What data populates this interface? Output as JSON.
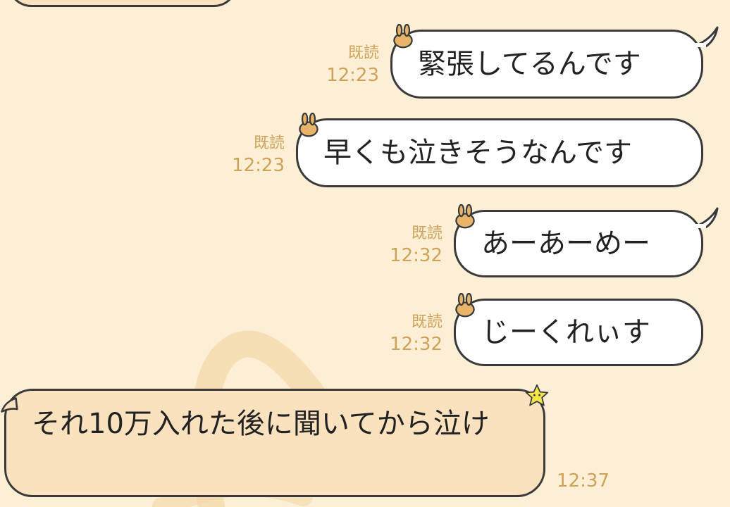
{
  "messages": [
    {
      "type": "sent",
      "read": "既読",
      "time": "12:23",
      "text": "緊張してるんです"
    },
    {
      "type": "sent",
      "read": "既読",
      "time": "12:23",
      "text": "早くも泣きそうなんです"
    },
    {
      "type": "sent",
      "read": "既読",
      "time": "12:32",
      "text": "あーあーめー"
    },
    {
      "type": "sent",
      "read": "既読",
      "time": "12:32",
      "text": "じーくれぃす"
    },
    {
      "type": "received",
      "time": "12:37",
      "text": "それ10万入れた後に聞いてから泣け"
    }
  ],
  "theme": {
    "background": "#FCEFD5",
    "sent_bubble": "#FFFFFF",
    "received_bubble": "#FBE2BE",
    "meta_text": "#CFA25A",
    "outline": "#3A3A3A"
  },
  "icons": [
    "bunny-ears-icon",
    "star-sticker-icon"
  ]
}
